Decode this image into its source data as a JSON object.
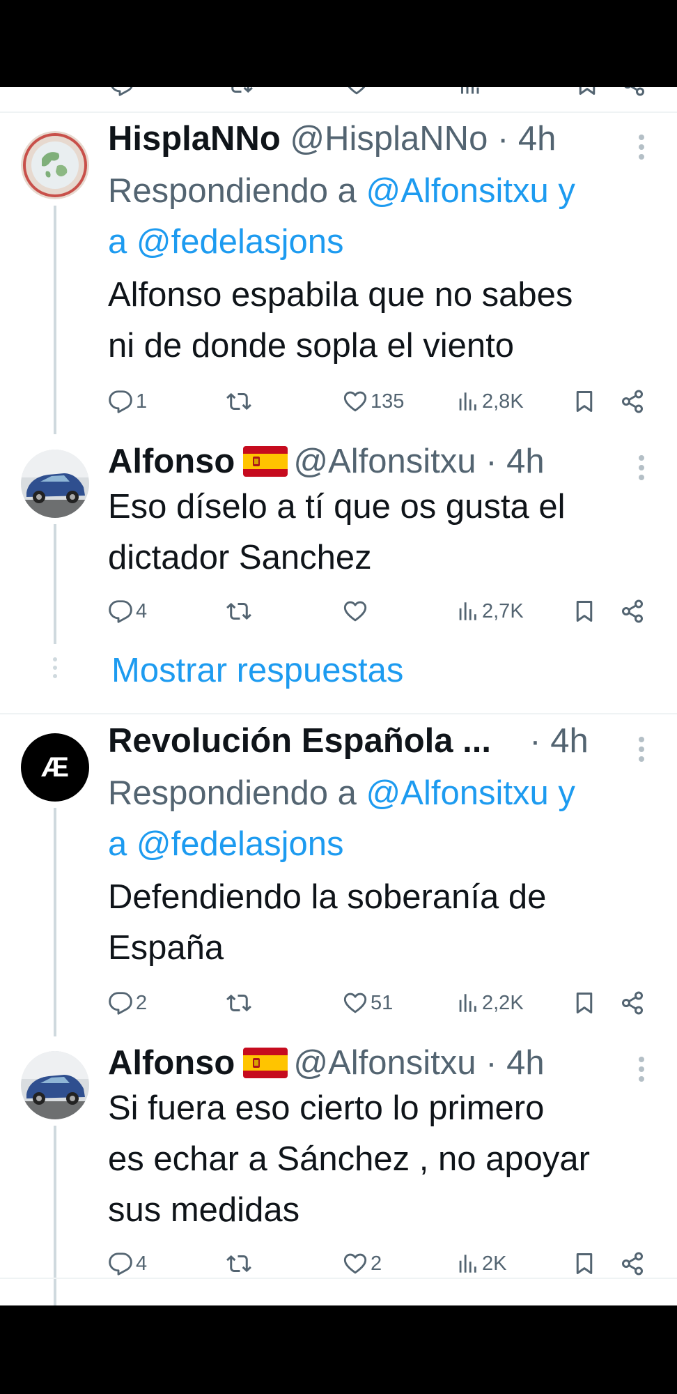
{
  "colors": {
    "accent": "#1d9bf0",
    "text_primary": "#0f1419",
    "text_secondary": "#536471",
    "thread_line": "#cfd9de"
  },
  "tweets": [
    {
      "name": "HisplaNNo",
      "handle": "@HisplaNNo",
      "separator": "·",
      "time": "4h",
      "replying_prefix": "Respondiendo a",
      "replying_user1": "@Alfonsitxu",
      "replying_and": "y",
      "replying_a": "a",
      "replying_user2": "@fedelasjons",
      "text_line1": "Alfonso espabila que no sabes",
      "text_line2": "ni de donde sopla el viento",
      "replies": "1",
      "retweets": "",
      "likes": "135",
      "views": "2,8K",
      "avatar_icon": "globe-avatar-icon"
    },
    {
      "name": "Alfonso",
      "flag_icon": "spain-flag-icon",
      "handle": "@Alfonsitxu",
      "separator": "·",
      "time": "4h",
      "text_line1": "Eso díselo a tí que os gusta el",
      "text_line2": "dictador Sanchez",
      "replies": "4",
      "retweets": "",
      "likes": "",
      "views": "2,7K",
      "avatar_icon": "car-avatar-icon"
    },
    {
      "name": "Revolución Española ...",
      "separator": "·",
      "time": "4h",
      "replying_prefix": "Respondiendo a",
      "replying_user1": "@Alfonsitxu",
      "replying_and": "y",
      "replying_a": "a",
      "replying_user2": "@fedelasjons",
      "text_line1": "Defendiendo la soberanía de",
      "text_line2": "España",
      "replies": "2",
      "retweets": "",
      "likes": "51",
      "views": "2,2K",
      "avatar_text": "Æ"
    },
    {
      "name": "Alfonso",
      "flag_icon": "spain-flag-icon",
      "handle": "@Alfonsitxu",
      "separator": "·",
      "time": "4h",
      "text_line1": "Si fuera eso cierto lo primero",
      "text_line2": "es echar a Sánchez , no apoyar",
      "text_line3": "sus medidas",
      "replies": "4",
      "retweets": "",
      "likes": "2",
      "views": "2K",
      "avatar_icon": "car-avatar-icon"
    }
  ],
  "show_replies_label": "Mostrar respuestas"
}
